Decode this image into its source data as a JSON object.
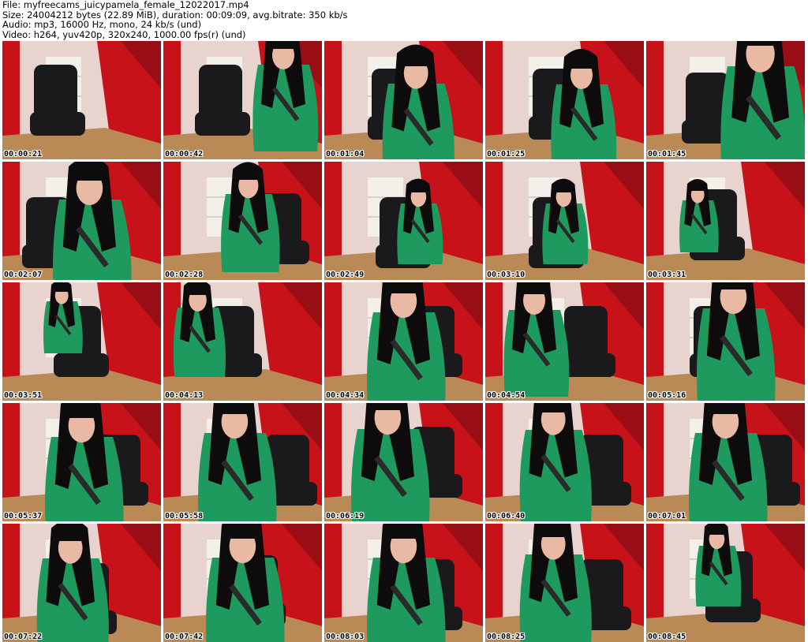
{
  "header": {
    "file_line": "File: myfreecams_juicypamela_female_12022017.mp4",
    "size_line": "Size: 24004212 bytes (22.89 MiB), duration: 00:09:09, avg.bitrate: 350 kb/s",
    "audio_line": "Audio: mp3, 16000 Hz, mono, 24 kb/s (und)",
    "video_line": "Video: h264, yuv420p, 320x240, 1000.00 fps(r) (und)"
  },
  "colors": {
    "wall_red": "#c8121a",
    "wall_dark": "#7a0a10",
    "dress_green": "#1f9a5e",
    "chair_black": "#1a1a1c",
    "hair_black": "#0d0b0c",
    "skin": "#e9b9a4",
    "floor": "#b98a55",
    "shelf_white": "#f3efe9",
    "curtain": "#e8d3cf"
  },
  "thumbnails": [
    {
      "timestamp": "00:00:21"
    },
    {
      "timestamp": "00:00:42"
    },
    {
      "timestamp": "00:01:04"
    },
    {
      "timestamp": "00:01:25"
    },
    {
      "timestamp": "00:01:45"
    },
    {
      "timestamp": "00:02:07"
    },
    {
      "timestamp": "00:02:28"
    },
    {
      "timestamp": "00:02:49"
    },
    {
      "timestamp": "00:03:10"
    },
    {
      "timestamp": "00:03:31"
    },
    {
      "timestamp": "00:03:51"
    },
    {
      "timestamp": "00:04:13"
    },
    {
      "timestamp": "00:04:34"
    },
    {
      "timestamp": "00:04:54"
    },
    {
      "timestamp": "00:05:16"
    },
    {
      "timestamp": "00:05:37"
    },
    {
      "timestamp": "00:05:58"
    },
    {
      "timestamp": "00:06:19"
    },
    {
      "timestamp": "00:06:40"
    },
    {
      "timestamp": "00:07:01"
    },
    {
      "timestamp": "00:07:22"
    },
    {
      "timestamp": "00:07:42"
    },
    {
      "timestamp": "00:08:03"
    },
    {
      "timestamp": "00:08:25"
    },
    {
      "timestamp": "00:08:45"
    }
  ]
}
